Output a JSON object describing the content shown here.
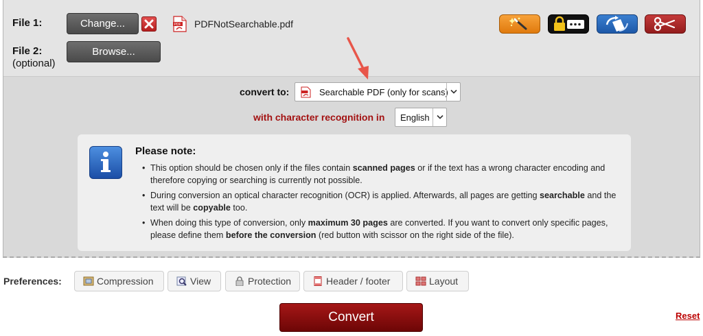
{
  "files": {
    "file1_label": "File 1:",
    "file2_label": "File 2:",
    "file2_sublabel": "(optional)",
    "change_button": "Change...",
    "browse_button": "Browse...",
    "file1_name": "PDFNotSearchable.pdf"
  },
  "convert": {
    "label": "convert to:",
    "selected": "Searchable PDF (only for scans)",
    "ocr_label": "with character recognition in",
    "ocr_language": "English"
  },
  "note": {
    "title": "Please note:",
    "items": [
      {
        "p1": "This option should be chosen only if the files contain ",
        "b1": "scanned pages",
        "p2": " or if the text has a wrong character encoding and therefore copying or searching is currently not possible.",
        "b2": "",
        "p3": ""
      },
      {
        "p1": "During conversion an optical character recognition (OCR) is applied. Afterwards, all pages are getting ",
        "b1": "searchable",
        "p2": " and the text will be ",
        "b2": "copyable",
        "p3": " too."
      },
      {
        "p1": "When doing this type of conversion, only ",
        "b1": "maximum 30 pages",
        "p2": " are converted. If you want to convert only specific pages, please define them ",
        "b2": "before the conversion",
        "p3": " (red button with scissor on the right side of the file)."
      }
    ]
  },
  "preferences": {
    "label": "Preferences:",
    "buttons": [
      "Compression",
      "View",
      "Protection",
      "Header / footer",
      "Layout"
    ]
  },
  "actions": {
    "convert_button": "Convert",
    "reset_link": "Reset"
  },
  "icons": {
    "remove_file": "close-icon",
    "pdf": "pdf-file-icon",
    "tools": [
      "magic-wand-icon",
      "password-lock-icon",
      "rotate-page-icon",
      "scissors-icon"
    ],
    "info": "info-icon"
  },
  "colors": {
    "convert_button": "#8a0f0f",
    "ocr_label": "#a31212",
    "reset_link": "#bb0000",
    "arrow": "#e8564a"
  }
}
